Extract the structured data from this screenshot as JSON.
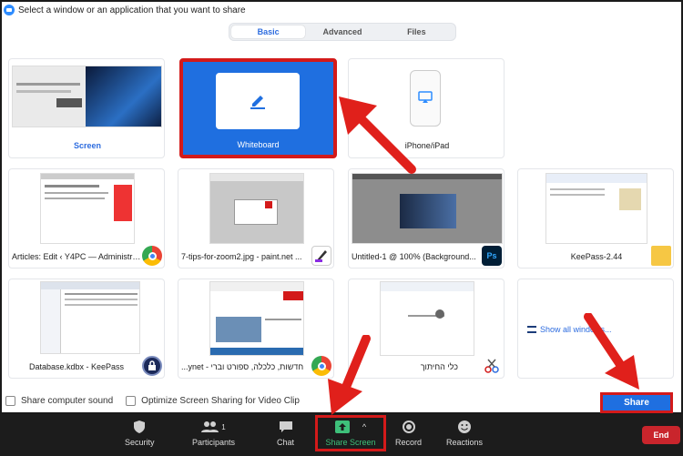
{
  "dialog": {
    "title": "Select a window or an application that you want to share",
    "tabs": [
      {
        "label": "Basic",
        "active": true
      },
      {
        "label": "Advanced",
        "active": false
      },
      {
        "label": "Files",
        "active": false
      }
    ]
  },
  "tiles": {
    "screen": {
      "label": "Screen"
    },
    "whiteboard": {
      "label": "Whiteboard"
    },
    "iphone": {
      "label": "iPhone/iPad"
    },
    "row2": [
      {
        "label": "Articles: Edit ‹ Y4PC — Administra...",
        "badge": "chrome-icon"
      },
      {
        "label": "7-tips-for-zoom2.jpg - paint.net ...",
        "badge": "paintnet-icon"
      },
      {
        "label": "Untitled-1 @ 100% (Background...",
        "badge": "Ps"
      },
      {
        "label": "KeePass-2.44",
        "badge": "folder-icon"
      }
    ],
    "row3": [
      {
        "label": "Database.kdbx - KeePass",
        "badge": "keepass-icon"
      },
      {
        "label": "...ynet - חדשות, כלכלה, ספורט וברי",
        "badge": "chrome-icon"
      },
      {
        "label": "כלי החיתוך",
        "badge": "snipping-icon"
      },
      {
        "label": "Show all windows..."
      }
    ]
  },
  "options": {
    "sound": "Share computer sound",
    "optimize": "Optimize Screen Sharing for Video Clip"
  },
  "share_button": "Share",
  "toolbar": {
    "items": [
      {
        "label": "Security"
      },
      {
        "label": "Participants",
        "count": "1"
      },
      {
        "label": "Chat"
      },
      {
        "label": "Share Screen"
      },
      {
        "label": "Record"
      },
      {
        "label": "Reactions"
      }
    ],
    "end": "End"
  },
  "colors": {
    "accent": "#1f6fe0",
    "highlight": "#d31a1a",
    "share_green": "#3ec07a"
  }
}
